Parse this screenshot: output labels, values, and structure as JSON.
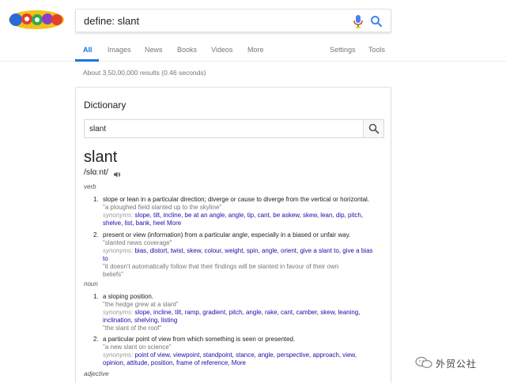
{
  "header": {
    "search_query": "define: slant",
    "tabs": [
      {
        "label": "All"
      },
      {
        "label": "Images"
      },
      {
        "label": "News"
      },
      {
        "label": "Books"
      },
      {
        "label": "Videos"
      },
      {
        "label": "More"
      },
      {
        "label": "Settings"
      },
      {
        "label": "Tools"
      }
    ],
    "logo_text": "GOOGLE"
  },
  "results_stats": "About 3,50,00,000 results (0.46 seconds)",
  "card": {
    "title": "Dictionary",
    "search_value": "slant",
    "headword": "slant",
    "pronunciation": "/slɑːnt/",
    "verb": {
      "pos": "verb",
      "senses": [
        {
          "num": "1.",
          "definition": "slope or lean in a particular direction; diverge or cause to diverge from the vertical or horizontal.",
          "example": "\"a ploughed field slanted up to the skyline\"",
          "synonyms_label": "synonyms:",
          "synonyms_text": "slope, tilt, incline, be at an angle, angle, tip, cant, be askew, skew, lean, dip, pitch,",
          "synonyms_text2": "shelve, list, bank, heel",
          "more": "More"
        },
        {
          "num": "2.",
          "definition": "present or view (information) from a particular angle, especially in a biased or unfair way.",
          "example": "\"slanted news coverage\"",
          "synonyms_label": "synonyms:",
          "synonyms_text": "bias, distort, twist, skew, colour, weight, spin, angle, orient, give a slant to, give a bias",
          "synonyms_text2": "to",
          "extra_example": "\"it doesn't automatically follow that their findings will be slanted in favour of their own",
          "extra_example2": "beliefs\""
        }
      ]
    },
    "noun": {
      "pos": "noun",
      "senses": [
        {
          "num": "1.",
          "definition": "a sloping position.",
          "example": "\"the hedge grew at a slant\"",
          "synonyms_label": "synonyms:",
          "synonyms_text": "slope, incline, tilt, ramp, gradient, pitch, angle, rake, cant, camber, skew, leaning,",
          "synonyms_text2": "inclination, shelving, listing",
          "extra_example": "\"the slant of the roof\""
        },
        {
          "num": "2.",
          "definition": "a particular point of view from which something is seen or presented.",
          "example": "\"a new slant on science\"",
          "synonyms_label": "synonyms:",
          "synonyms_text": "point of view, viewpoint, standpoint, stance, angle, perspective, approach, view,",
          "synonyms_text2": "opinion, attitude, position, frame of reference,",
          "more": "More"
        }
      ]
    },
    "adjective": {
      "pos": "adjective"
    }
  },
  "watermark": {
    "text": "外贸公社"
  },
  "colors": {
    "accent": "#1a73e8",
    "link": "#1a0dab",
    "muted": "#777777"
  },
  "icons": {
    "mic": "mic-icon",
    "search": "search-icon",
    "speaker": "speaker-icon"
  }
}
